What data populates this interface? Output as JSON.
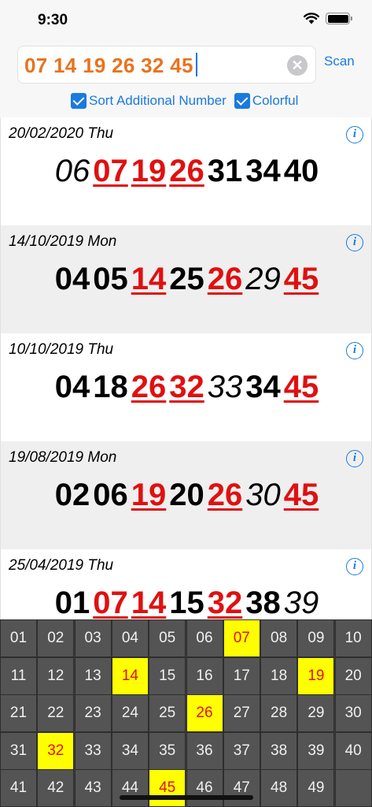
{
  "status_bar": {
    "time": "9:30"
  },
  "search": {
    "value": "07 14 19 26 32 45",
    "clear_icon": "clear-circle-icon",
    "scan_label": "Scan"
  },
  "options": [
    {
      "label": "Sort Additional Number",
      "checked": true
    },
    {
      "label": "Colorful",
      "checked": true
    }
  ],
  "results": [
    {
      "date": "20/02/2020 Thu",
      "numbers": [
        {
          "n": "06",
          "hit": false,
          "additional": true
        },
        {
          "n": "07",
          "hit": true,
          "additional": false
        },
        {
          "n": "19",
          "hit": true,
          "additional": false
        },
        {
          "n": "26",
          "hit": true,
          "additional": false
        },
        {
          "n": "31",
          "hit": false,
          "additional": false
        },
        {
          "n": "34",
          "hit": false,
          "additional": false
        },
        {
          "n": "40",
          "hit": false,
          "additional": false
        }
      ]
    },
    {
      "date": "14/10/2019 Mon",
      "numbers": [
        {
          "n": "04",
          "hit": false,
          "additional": false
        },
        {
          "n": "05",
          "hit": false,
          "additional": false
        },
        {
          "n": "14",
          "hit": true,
          "additional": false
        },
        {
          "n": "25",
          "hit": false,
          "additional": false
        },
        {
          "n": "26",
          "hit": true,
          "additional": false
        },
        {
          "n": "29",
          "hit": false,
          "additional": true
        },
        {
          "n": "45",
          "hit": true,
          "additional": false
        }
      ]
    },
    {
      "date": "10/10/2019 Thu",
      "numbers": [
        {
          "n": "04",
          "hit": false,
          "additional": false
        },
        {
          "n": "18",
          "hit": false,
          "additional": false
        },
        {
          "n": "26",
          "hit": true,
          "additional": false
        },
        {
          "n": "32",
          "hit": true,
          "additional": false
        },
        {
          "n": "33",
          "hit": false,
          "additional": true
        },
        {
          "n": "34",
          "hit": false,
          "additional": false
        },
        {
          "n": "45",
          "hit": true,
          "additional": false
        }
      ]
    },
    {
      "date": "19/08/2019 Mon",
      "numbers": [
        {
          "n": "02",
          "hit": false,
          "additional": false
        },
        {
          "n": "06",
          "hit": false,
          "additional": false
        },
        {
          "n": "19",
          "hit": true,
          "additional": false
        },
        {
          "n": "20",
          "hit": false,
          "additional": false
        },
        {
          "n": "26",
          "hit": true,
          "additional": false
        },
        {
          "n": "30",
          "hit": false,
          "additional": true
        },
        {
          "n": "45",
          "hit": true,
          "additional": false
        }
      ]
    },
    {
      "date": "25/04/2019 Thu",
      "numbers": [
        {
          "n": "01",
          "hit": false,
          "additional": false
        },
        {
          "n": "07",
          "hit": true,
          "additional": false
        },
        {
          "n": "14",
          "hit": true,
          "additional": false
        },
        {
          "n": "15",
          "hit": false,
          "additional": false
        },
        {
          "n": "32",
          "hit": true,
          "additional": false
        },
        {
          "n": "38",
          "hit": false,
          "additional": false
        },
        {
          "n": "39",
          "hit": false,
          "additional": true
        }
      ]
    }
  ],
  "keypad": {
    "keys": [
      "01",
      "02",
      "03",
      "04",
      "05",
      "06",
      "07",
      "08",
      "09",
      "10",
      "11",
      "12",
      "13",
      "14",
      "15",
      "16",
      "17",
      "18",
      "19",
      "20",
      "21",
      "22",
      "23",
      "24",
      "25",
      "26",
      "27",
      "28",
      "29",
      "30",
      "31",
      "32",
      "33",
      "34",
      "35",
      "36",
      "37",
      "38",
      "39",
      "40",
      "41",
      "42",
      "43",
      "44",
      "45",
      "46",
      "47",
      "48",
      "49"
    ],
    "selected": [
      "07",
      "14",
      "19",
      "26",
      "32",
      "45"
    ]
  },
  "colors": {
    "accent": "#1a7ae0",
    "input_text": "#e8731e",
    "hit": "#e01010",
    "selected_key": "#ffff00"
  }
}
